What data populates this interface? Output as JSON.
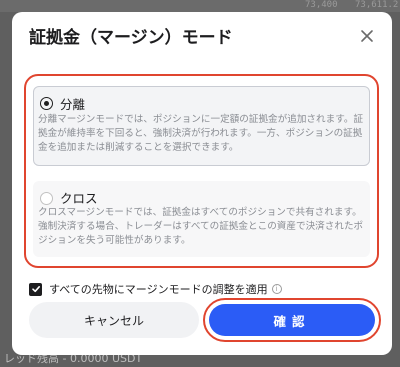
{
  "background": {
    "top_value_a": "73,400",
    "top_value_b": "73,611.2",
    "bottom_text": "レッド残高 - 0.0000 USDT"
  },
  "dialog": {
    "title": "証拠金（マージン）モード",
    "close_icon": "close-icon",
    "options": [
      {
        "label": "分離",
        "description": "分離マージンモードでは、ポジションに一定額の証拠金が追加されます。証拠金が維持率を下回ると、強制決済が行われます。一方、ポジションの証拠金を追加または削減することを選択できます。",
        "selected": true
      },
      {
        "label": "クロス",
        "description": "クロスマージンモードでは、証拠金はすべてのポジションで共有されます。強制決済する場合、トレーダーはすべての証拠金とこの資産で決済されたポジションを失う可能性があります。",
        "selected": false
      }
    ],
    "apply_all": {
      "label": "すべての先物にマージンモードの調整を適用",
      "checked": true,
      "info_icon": "info-icon"
    },
    "cancel_label": "キャンセル",
    "confirm_label": "確認"
  },
  "colors": {
    "accent_blue": "#2b5cf6",
    "highlight_red": "#e0452f"
  }
}
